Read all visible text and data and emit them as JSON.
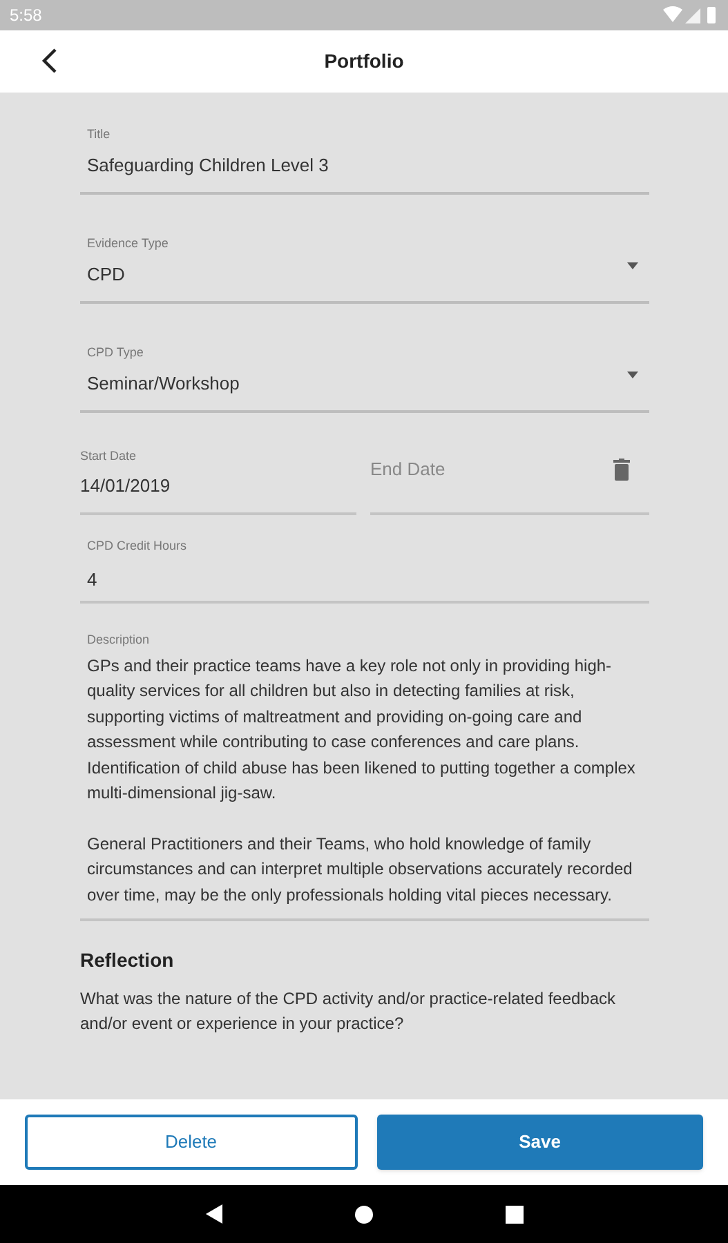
{
  "status_bar": {
    "time": "5:58"
  },
  "app_bar": {
    "title": "Portfolio"
  },
  "fields": [
    {
      "kind": "text",
      "label": "Title",
      "value": "Safeguarding Children Level 3"
    },
    {
      "kind": "select",
      "label": "Evidence Type",
      "value": "CPD"
    },
    {
      "kind": "select",
      "label": "CPD Type",
      "value": "Seminar/Workshop"
    }
  ],
  "dates": {
    "start": {
      "label": "Start Date",
      "value": "14/01/2019"
    },
    "end": {
      "placeholder": "End Date"
    }
  },
  "credit_hours": {
    "label": "CPD Credit Hours",
    "value": "4"
  },
  "description": {
    "label": "Description",
    "paragraphs": [
      "GPs and their practice teams have a key role not only in providing high-quality services for all children but also in detecting families at risk, supporting victims of maltreatment and providing on-going care and assessment while contributing to case conferences and care plans. Identification of child abuse has been likened to putting together a complex multi-dimensional jig-saw.",
      "General Practitioners and their Teams, who hold knowledge of family circumstances and can interpret multiple observations accurately recorded over time, may be the only professionals holding vital pieces necessary."
    ]
  },
  "reflection": {
    "heading": "Reflection",
    "question": "What was the nature of the CPD activity and/or practice-related feedback and/or event or experience in your practice?"
  },
  "buttons": [
    {
      "kind": "outline",
      "label": "Delete"
    },
    {
      "kind": "filled",
      "label": "Save"
    }
  ]
}
